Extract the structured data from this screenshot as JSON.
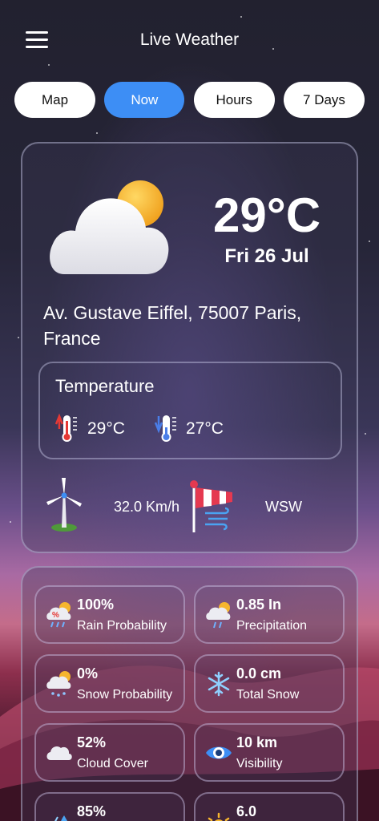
{
  "header": {
    "title": "Live Weather"
  },
  "tabs": [
    {
      "label": "Map",
      "active": false
    },
    {
      "label": "Now",
      "active": true
    },
    {
      "label": "Hours",
      "active": false
    },
    {
      "label": "7 Days",
      "active": false
    }
  ],
  "current": {
    "icon": "partly-cloudy-icon",
    "temperature": "29°C",
    "date": "Fri 26 Jul",
    "address": "Av. Gustave Eiffel, 75007 Paris, France"
  },
  "temperature_box": {
    "title": "Temperature",
    "high": "29°C",
    "low": "27°C"
  },
  "wind": {
    "speed": "32.0 Km/h",
    "direction": "WSW"
  },
  "details": [
    {
      "value": "100%",
      "label": "Rain Probability",
      "icon": "rain-probability-icon"
    },
    {
      "value": "0.85 In",
      "label": "Precipitation",
      "icon": "precipitation-icon"
    },
    {
      "value": "0%",
      "label": "Snow Probability",
      "icon": "snow-probability-icon"
    },
    {
      "value": "0.0 cm",
      "label": "Total Snow",
      "icon": "snowflake-icon"
    },
    {
      "value": "52%",
      "label": "Cloud Cover",
      "icon": "cloud-icon"
    },
    {
      "value": "10 km",
      "label": "Visibility",
      "icon": "eye-icon"
    },
    {
      "value": "85%",
      "label": "",
      "icon": "humidity-icon"
    },
    {
      "value": "6.0",
      "label": "",
      "icon": "sun-uv-icon"
    }
  ],
  "colors": {
    "accent": "#3d8ef5",
    "sun": "#f6b52e"
  }
}
